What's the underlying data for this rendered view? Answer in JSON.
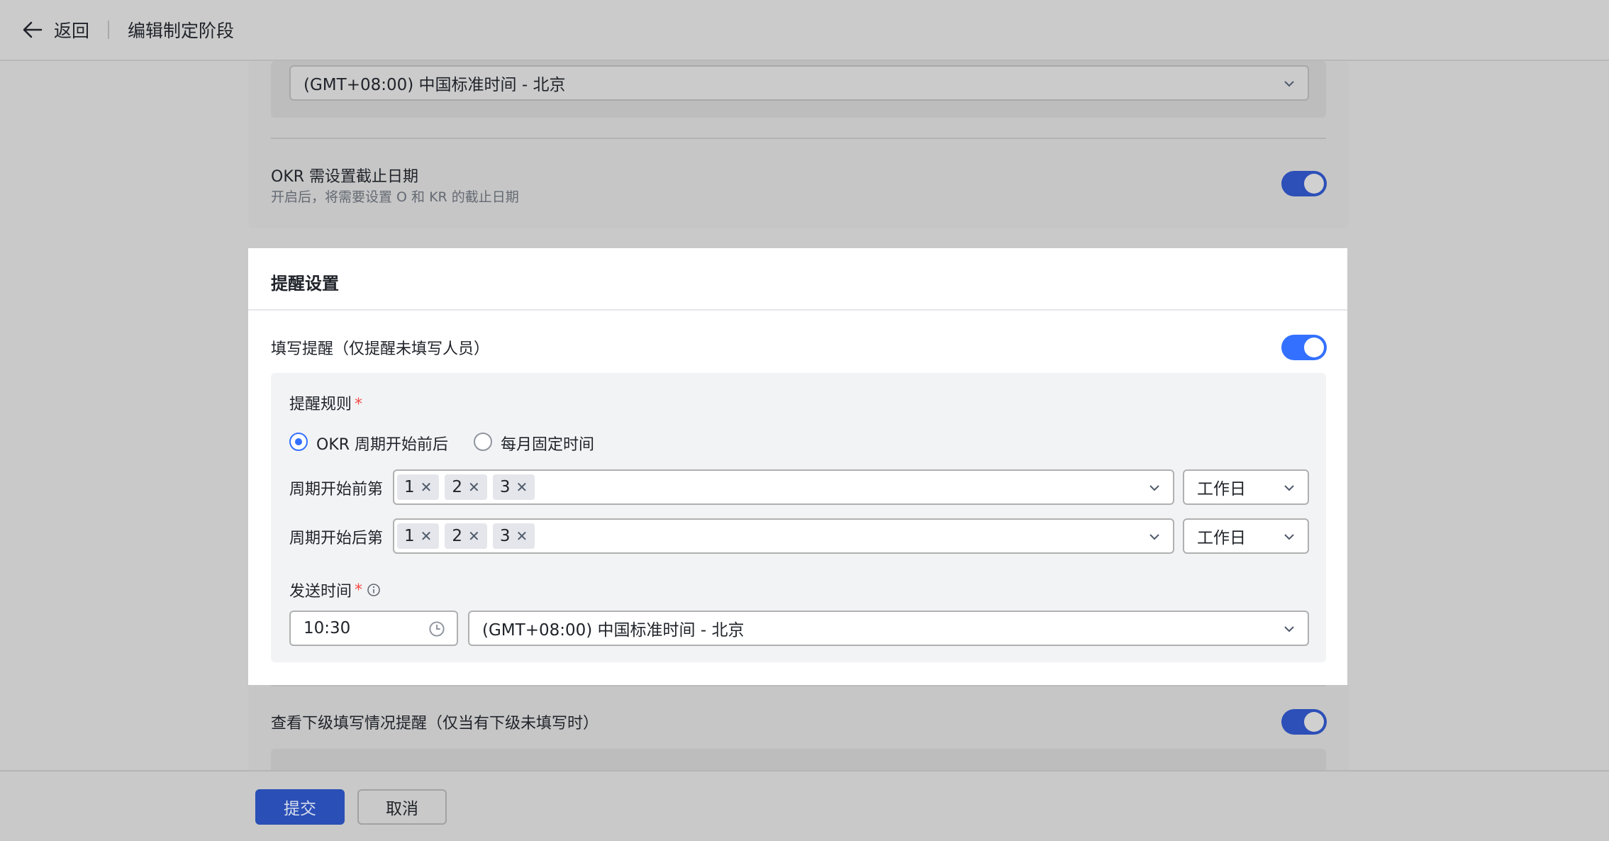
{
  "header": {
    "back_label": "返回",
    "title": "编辑制定阶段"
  },
  "top_section": {
    "timezone_value": "(GMT+08:00) 中国标准时间 - 北京",
    "deadline_title": "OKR 需设置截止日期",
    "deadline_desc": "开启后，将需要设置 O 和 KR 的截止日期",
    "deadline_toggle": true
  },
  "reminder": {
    "section_title": "提醒设置",
    "fill_title": "填写提醒（仅提醒未填写人员）",
    "fill_toggle": true,
    "rule_label": "提醒规则",
    "required_mark": "*",
    "radio_options": [
      {
        "label": "OKR 周期开始前后",
        "checked": true
      },
      {
        "label": "每月固定时间",
        "checked": false
      }
    ],
    "before_label": "周期开始前第",
    "before_tags": [
      "1",
      "2",
      "3"
    ],
    "before_unit": "工作日",
    "after_label": "周期开始后第",
    "after_tags": [
      "1",
      "2",
      "3"
    ],
    "after_unit": "工作日",
    "send_time_label": "发送时间",
    "time_value": "10:30",
    "timezone_value": "(GMT+08:00) 中国标准时间 - 北京",
    "sub_title": "查看下级填写情况提醒（仅当有下级未填写时）",
    "sub_toggle": true
  },
  "footer": {
    "submit_label": "提交",
    "cancel_label": "取消"
  },
  "colors": {
    "accent": "#3370ff",
    "accent_dim": "#2a4fb6",
    "overlay": "#c9c9c9",
    "required": "#f54a45"
  }
}
